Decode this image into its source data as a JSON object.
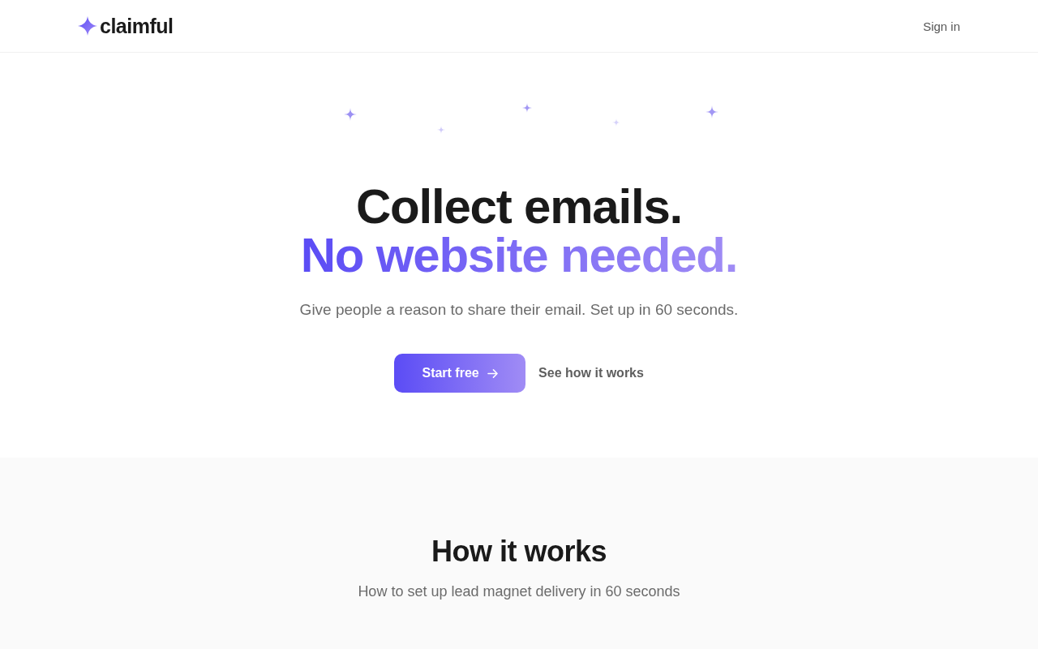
{
  "header": {
    "logo": "claimful",
    "sign_in": "Sign in"
  },
  "hero": {
    "headline": "Collect emails.",
    "headline_accent": "No website needed.",
    "subtitle": "Give people a reason to share their email. Set up in 60 seconds.",
    "primary_button": "Start free",
    "secondary_link": "See how it works"
  },
  "how_it_works": {
    "title": "How it works",
    "subtitle": "How to set up lead magnet delivery in 60 seconds"
  }
}
